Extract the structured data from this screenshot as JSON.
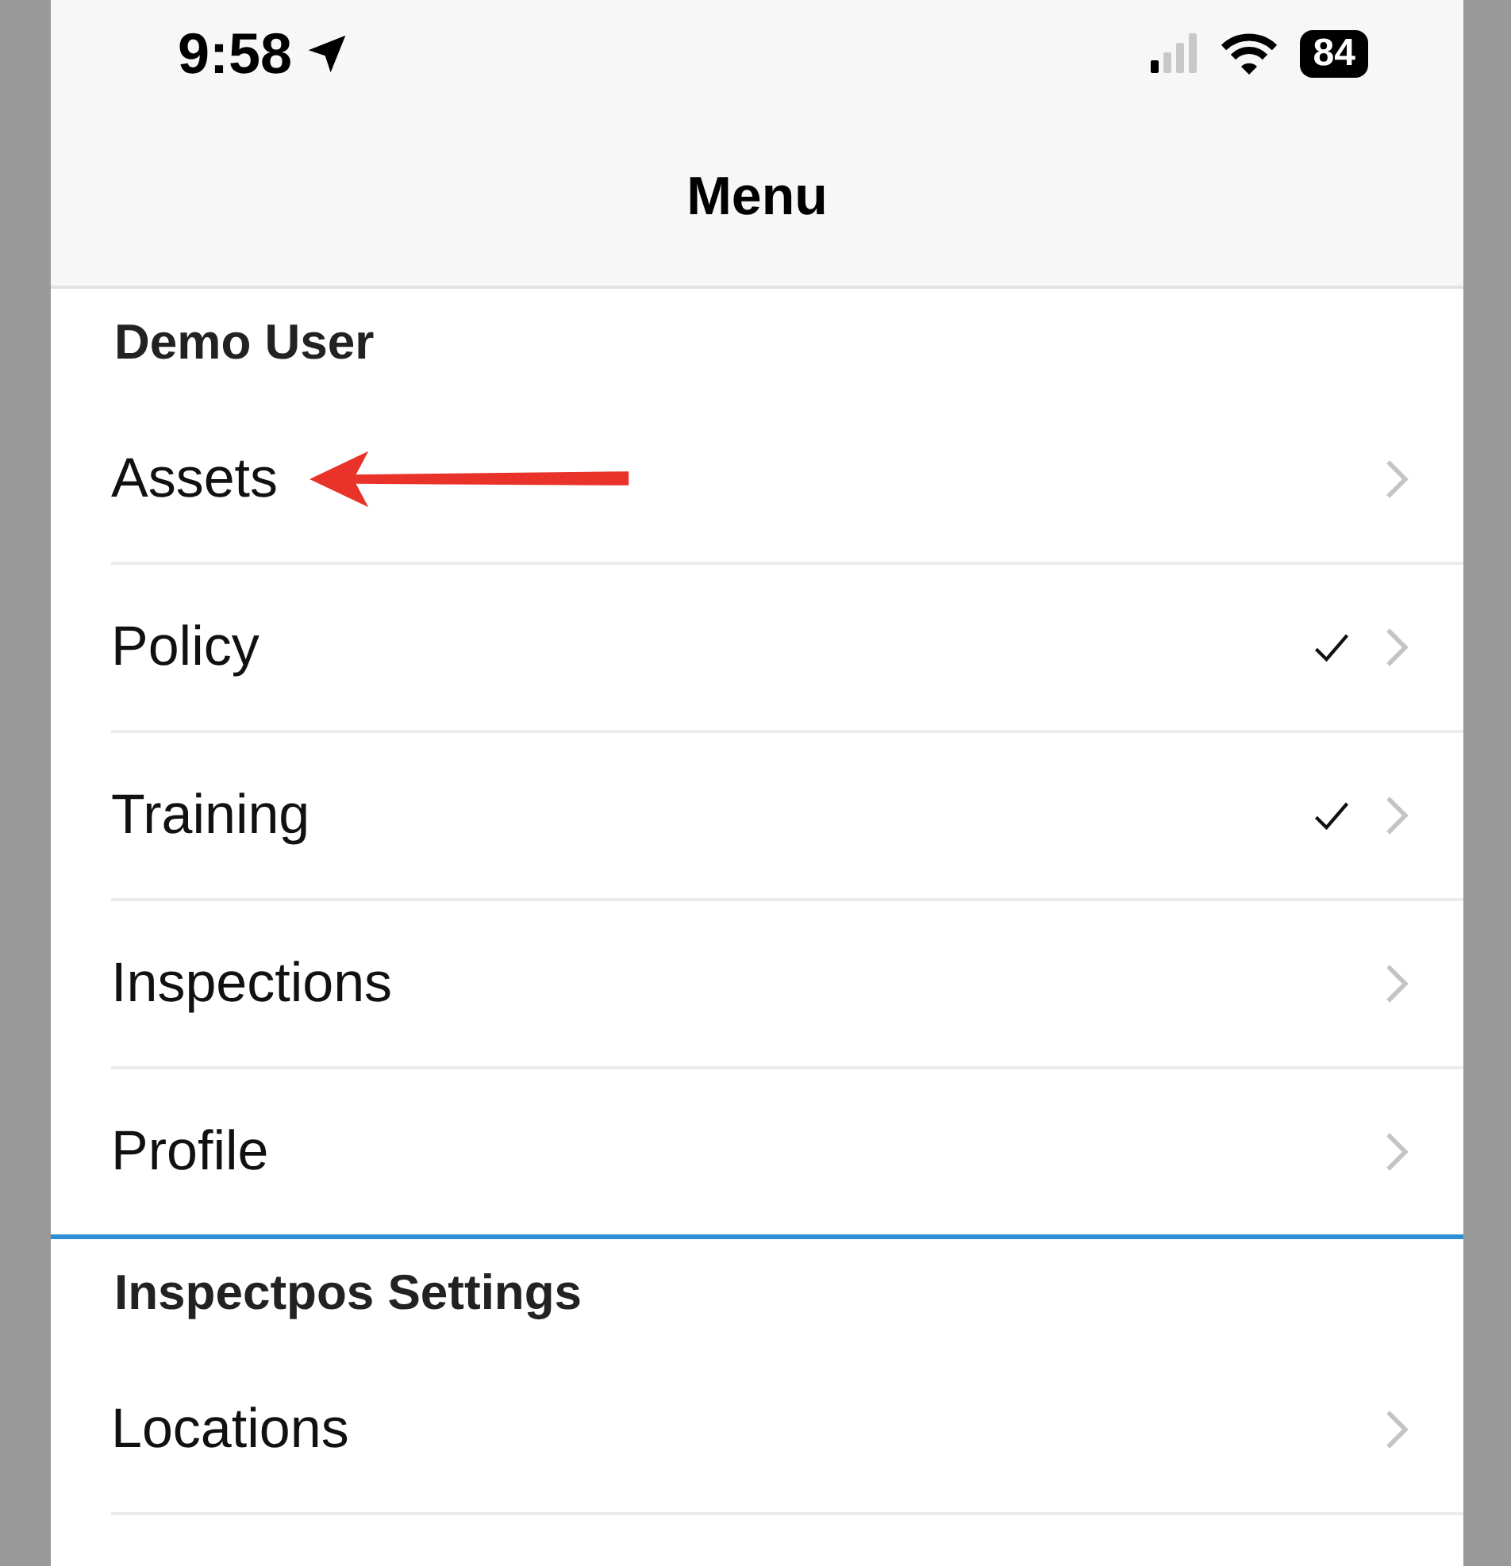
{
  "status_bar": {
    "time": "9:58",
    "battery": "84"
  },
  "nav_title": "Menu",
  "sections": [
    {
      "title": "Demo User",
      "items": [
        {
          "label": "Assets",
          "checked": false,
          "pointer_arrow": true
        },
        {
          "label": "Policy",
          "checked": true,
          "pointer_arrow": false
        },
        {
          "label": "Training",
          "checked": true,
          "pointer_arrow": false
        },
        {
          "label": "Inspections",
          "checked": false,
          "pointer_arrow": false
        },
        {
          "label": "Profile",
          "checked": false,
          "pointer_arrow": false
        }
      ]
    },
    {
      "title": "Inspectpos Settings",
      "items": [
        {
          "label": "Locations",
          "checked": false,
          "pointer_arrow": false
        }
      ]
    }
  ]
}
